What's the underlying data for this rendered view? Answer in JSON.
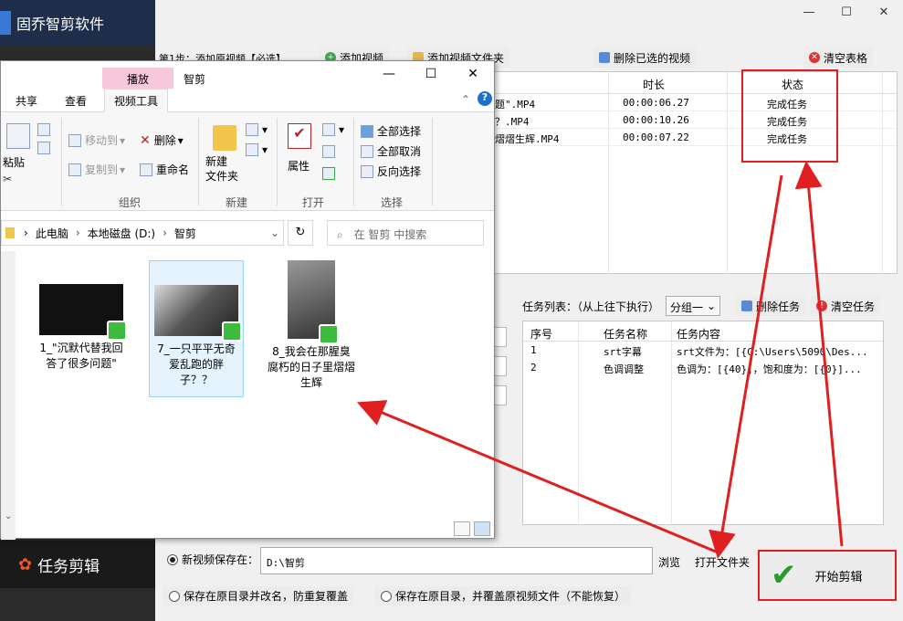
{
  "app": {
    "title": "固乔智剪软件",
    "window_controls": {
      "minimize": "—",
      "maximize": "☐",
      "close": "✕"
    },
    "sidebar": {
      "task_label": "任务剪辑"
    }
  },
  "step1": {
    "label": "第1步：添加原视频【必选】",
    "buttons": {
      "add_video": "添加视频",
      "add_folder": "添加视频文件夹",
      "delete_selected": "删除已选的视频",
      "clear_table": "清空表格"
    }
  },
  "video_table": {
    "columns": {
      "duration": "时长",
      "status": "状态"
    },
    "rows": [
      {
        "name": "题\".MP4",
        "duration": "00:00:06.27",
        "status": "完成任务"
      },
      {
        "name": "？.MP4",
        "duration": "00:00:10.26",
        "status": "完成任务"
      },
      {
        "name": "熠熠生辉.MP4",
        "duration": "00:00:07.22",
        "status": "完成任务"
      }
    ]
  },
  "task_panel": {
    "label": "任务列表：（从上往下执行）",
    "group": "分组一",
    "delete_task": "删除任务",
    "clear_tasks": "清空任务",
    "columns": {
      "seq": "序号",
      "name": "任务名称",
      "content": "任务内容"
    },
    "rows": [
      {
        "seq": "1",
        "name": "srt字幕",
        "content": "srt文件为：[{C:\\Users\\5090\\Des..."
      },
      {
        "seq": "2",
        "name": "色调调整",
        "content": "色调为：[{40}]，饱和度为：[{0}]..."
      }
    ]
  },
  "output": {
    "save_new_label": "新视频保存在：",
    "path": "D:\\智剪",
    "browse": "浏览",
    "open_folder": "打开文件夹",
    "opt_rename": "保存在原目录并改名，防重复覆盖",
    "opt_overwrite": "保存在原目录，并覆盖原视频文件（不能恢复）",
    "start": "开始剪辑"
  },
  "explorer": {
    "context_tab": "播放",
    "title": "智剪",
    "window_controls": {
      "minimize": "—",
      "maximize": "☐",
      "close": "✕"
    },
    "tabs": {
      "share": "共享",
      "view": "查看",
      "video_tools": "视频工具"
    },
    "ribbon": {
      "paste": "粘贴",
      "move_to": "移动到",
      "copy_to": "复制到",
      "delete": "删除",
      "rename": "重命名",
      "new_folder": "新建\n文件夹",
      "properties": "属性",
      "select_all": "全部选择",
      "select_none": "全部取消",
      "invert": "反向选择",
      "group_organize": "组织",
      "group_new": "新建",
      "group_open": "打开",
      "group_select": "选择"
    },
    "address": {
      "pc": "此电脑",
      "disk": "本地磁盘 (D:)",
      "folder": "智剪"
    },
    "search_placeholder": "在 智剪 中搜索",
    "files": [
      {
        "name": "1_\"沉默代替我回答了很多问题\""
      },
      {
        "name": "7_一只平平无奇爱乱跑的胖子？？"
      },
      {
        "name": "8_我会在那腥臭腐朽的日子里熠熠生辉"
      }
    ]
  },
  "colors": {
    "highlight": "#e02020",
    "accent_green": "#2b9a2b",
    "title_bar": "#1e2e4a"
  }
}
